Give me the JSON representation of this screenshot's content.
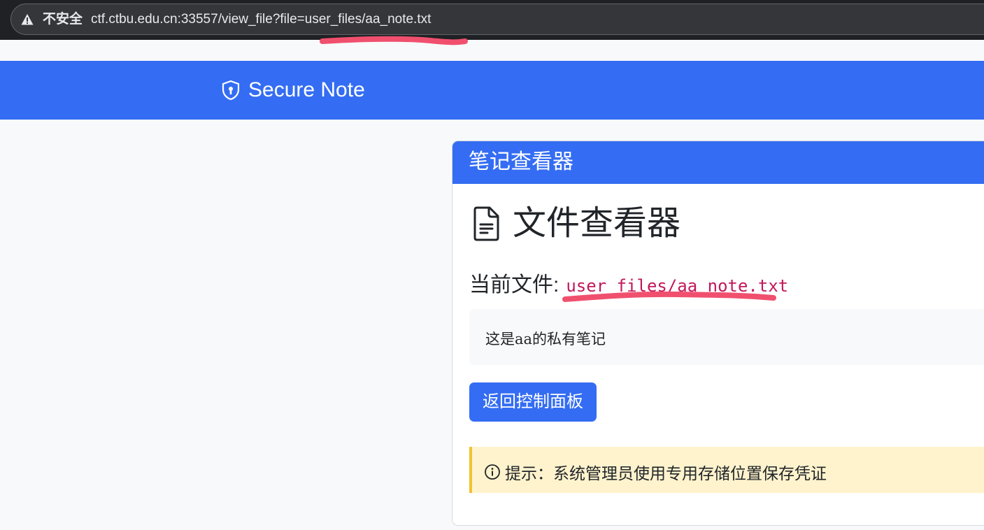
{
  "browser": {
    "security_label": "不安全",
    "url": "ctf.ctbu.edu.cn:33557/view_file?file=user_files/aa_note.txt"
  },
  "navbar": {
    "brand": "Secure Note",
    "brand_icon": "shield-icon"
  },
  "card": {
    "header_title": "笔记查看器",
    "heading": "文件查看器",
    "heading_icon": "file-text-icon",
    "current_file_label": "当前文件:",
    "current_file_path": "user_files/aa_note.txt",
    "file_content": "这是aa的私有笔记",
    "back_button": "返回控制面板",
    "hint_icon": "info-circle-icon",
    "hint_text": "提示：系统管理员使用专用存储位置保存凭证"
  },
  "colors": {
    "primary": "#346df3",
    "code": "#c2185b",
    "alert_bg": "#fff3cd",
    "alert_border": "#f1c231",
    "annotation_marker": "#f0506e"
  }
}
